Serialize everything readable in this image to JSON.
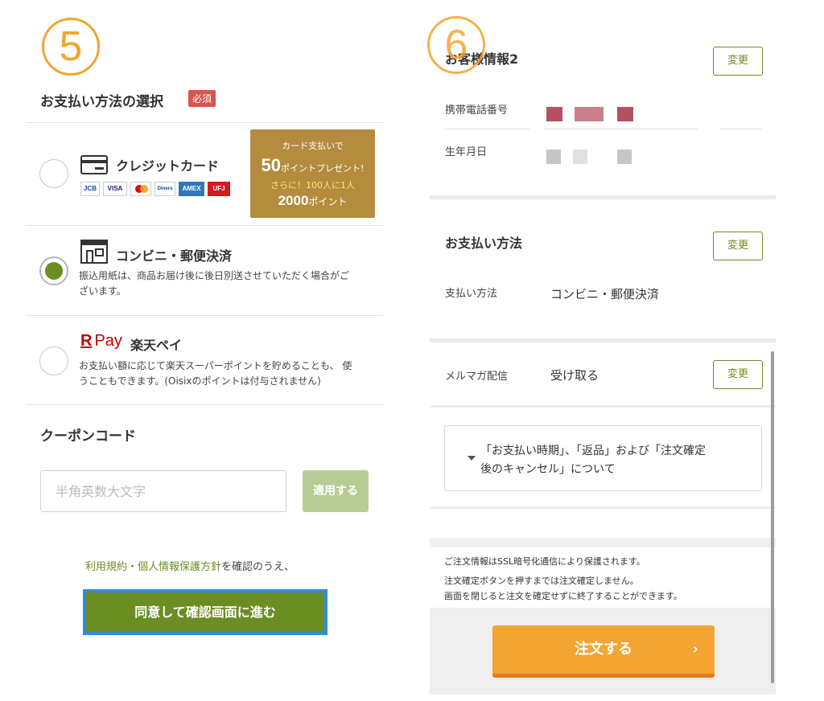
{
  "steps": {
    "left": "5",
    "right": "6"
  },
  "colors": {
    "accent_green": "#6b8e23",
    "accent_orange": "#f3a531",
    "required_red": "#d9534f",
    "focus_blue": "#2f8be4"
  },
  "payment": {
    "title": "お支払い方法の選択",
    "required_badge": "必須",
    "options": [
      {
        "label": "クレジットカード",
        "icon": "credit-card-icon",
        "selected": false
      },
      {
        "label": "コンビニ・郵便決済",
        "icon": "convenience-store-icon",
        "selected": true,
        "desc_line1": "振込用紙は、商品お届け後に後日別送させていただく場合がご",
        "desc_line2": "ざいます。"
      },
      {
        "label": "楽天ペイ",
        "logo_r": "R",
        "logo_pay": "Pay",
        "icon": "rakuten-pay-logo",
        "selected": false,
        "desc_line1": "お支払い額に応じて楽天スーパーポイントを貯めることも、 使",
        "desc_line2": "うこともできます。(Oisixのポイントは付与されません)"
      }
    ],
    "card_brands": [
      "JCB",
      "VISA",
      "MC",
      "Diners",
      "AMEX",
      "UFJ"
    ],
    "promo": {
      "line1": "カード支払いで",
      "line2_num": "50",
      "line2_rest": "ポイントプレゼント!",
      "line3": "さらに！100人に1人",
      "line4_num": "2000",
      "line4_rest": "ポイント"
    }
  },
  "coupon": {
    "title": "クーポンコード",
    "placeholder": "半角英数大文字",
    "apply_label": "適用する"
  },
  "terms": {
    "link1": "利用規約",
    "sep": "・",
    "link2": "個人情報保護方針",
    "rest": "を確認のうえ、"
  },
  "agree_button": "同意して確認画面に進む",
  "customer": {
    "title": "お客様情報2",
    "change_label": "変更",
    "phone_label": "携帯電話番号",
    "birth_label": "生年月日"
  },
  "payment_method": {
    "title": "お支払い方法",
    "change_label": "変更",
    "label": "支払い方法",
    "value": "コンビニ・郵便決済"
  },
  "newsletter": {
    "label": "メルマガ配信",
    "value": "受け取る",
    "change_label": "変更"
  },
  "notice": {
    "line1": "「お支払い時期」、「返品」および「注文確定",
    "line2": "後のキャンセル」について"
  },
  "info": {
    "ssl": "ご注文情報はSSL暗号化通信により保護されます。",
    "line2": "注文確定ボタンを押すまでは注文確定しません。",
    "line3": "画面を閉じると注文を確定せずに終了することができます。"
  },
  "order_button": "注文する",
  "order_chevron": "›"
}
